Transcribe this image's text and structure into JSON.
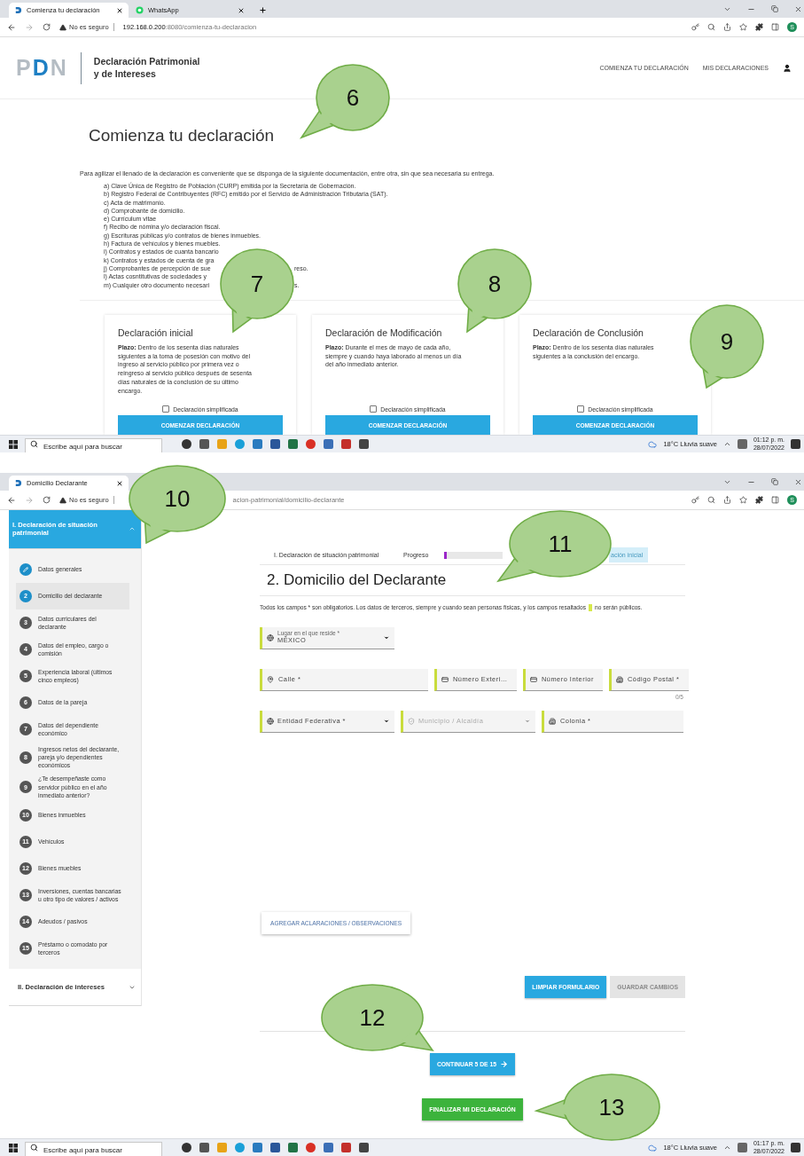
{
  "screen_1": {
    "browser": {
      "tabs": [
        {
          "title": "Comienza tu declaración",
          "kind": "pdn",
          "selected": true
        },
        {
          "title": "WhatsApp",
          "kind": "chat",
          "selected": false
        }
      ],
      "security": "No es seguro",
      "url": "**192.168.0.200**:8080/comienza-tu-declaracion",
      "profile_initial": "S"
    },
    "header": {
      "logo": "PDN",
      "app_title": [
        "Declaración Patrimonial",
        "y de Intereses"
      ],
      "nav": [
        "COMIENZA TU DECLARACIÓN",
        "MIS DECLARACIONES"
      ]
    },
    "title": "Comienza tu declaración",
    "intro": "Para agilizar el llenado de la declaración es conveniente que se disponga de la siguiente documentación, entre otra, sin que sea necesaria su entrega.",
    "documents": [
      {
        "text": "a) Clave Única de Registro de Población (CURP) emitida por la Secretaría de Gobernación."
      },
      {
        "text": "b) Registro Federal de Contribuyentes (RFC) emitido por el Servicio de Administración Tributaria (SAT)."
      },
      {
        "text": "c) Acta de matrimonio."
      },
      {
        "text": "d) Comprobante de domicilio."
      },
      {
        "text": "e) Currículum vitae"
      },
      {
        "text": "f) Recibo de nómina y/o declaración fiscal."
      },
      {
        "text": "g) Escrituras públicas y/o contratos de bienes inmuebles."
      },
      {
        "text": "h) Factura de vehículos y bienes muebles."
      },
      {
        "text": "i) Contratos y estados de cuanta bancario"
      },
      {
        "text": "k) Contratos y estados de cuenta de gra"
      },
      {
        "text": "j) Comprobantes de percepción de sue",
        "tail": "reso."
      },
      {
        "text": "l) Actas cosntitutivas de sociedades y"
      },
      {
        "text": "m) Cualquier otro documento necesari",
        "tail": "s."
      }
    ],
    "cards": [
      {
        "title": "Declaración inicial",
        "deadline": "**Plazo:** Dentro de los sesenta días naturales siguientes a la toma de posesión con motivo del ingreso al servicio público por primera vez o reingreso al servicio público después de sesenta días naturales de la conclusión de su último encargo.",
        "checkbox": "Declaración simplificada",
        "checked": false,
        "button": "COMENZAR DECLARACIÓN"
      },
      {
        "title": "Declaración de Modificación",
        "deadline": "**Plazo:** Durante el mes de mayo de cada año, siempre y cuando haya laborado al menos un día del año inmediato anterior.",
        "checkbox": "Declaración simplificada",
        "checked": false,
        "button": "COMENZAR DECLARACIÓN"
      },
      {
        "title": "Declaración de Conclusión",
        "deadline": "**Plazo:** Dentro de los sesenta días naturales siguientes a la conclusión del encargo.",
        "checkbox": "Declaración simplificada",
        "checked": false,
        "button": "COMENZAR DECLARACIÓN"
      }
    ],
    "taskbar": {
      "search_placeholder": "Escribe aquí para buscar",
      "weather": "18°C Lluvia suave",
      "time": "01:12 p. m.",
      "date": "28/07/2022"
    }
  },
  "screen_2": {
    "browser": {
      "tabs": [
        {
          "title": "Domicilio Declarante",
          "kind": "pdn",
          "selected": true
        }
      ],
      "security": "No es seguro",
      "url": "acion-patrimonial/domicilio-declarante",
      "profile_initial": "S"
    },
    "sidebar": {
      "sections": [
        {
          "title": "I. Declaración de situación patrimonial",
          "expanded": true,
          "steps": [
            {
              "kind": "edit",
              "label": "Datos generales",
              "selected": false
            },
            {
              "kind": "number",
              "number": "2",
              "label": "Domicilio del declarante",
              "selected": true
            },
            {
              "kind": "number",
              "number": "3",
              "label": "Datos curriculares del declarante",
              "selected": false
            },
            {
              "kind": "number",
              "number": "4",
              "label": "Datos del empleo, cargo o comisión",
              "selected": false
            },
            {
              "kind": "number",
              "number": "5",
              "label": "Experiencia laboral (últimos cinco empleos)",
              "selected": false
            },
            {
              "kind": "number",
              "number": "6",
              "label": "Datos de la pareja",
              "selected": false
            },
            {
              "kind": "number",
              "number": "7",
              "label": "Datos del dependiente económico",
              "selected": false
            },
            {
              "kind": "number",
              "number": "8",
              "label": "Ingresos netos del declarante, pareja y/o dependientes económicos",
              "selected": false
            },
            {
              "kind": "number",
              "number": "9",
              "label": "¿Te desempeñaste como servidor público en el año inmediato anterior?",
              "selected": false
            },
            {
              "kind": "number",
              "number": "10",
              "label": "Bienes inmuebles",
              "selected": false
            },
            {
              "kind": "number",
              "number": "11",
              "label": "Vehículos",
              "selected": false
            },
            {
              "kind": "number",
              "number": "12",
              "label": "Bienes muebles",
              "selected": false
            },
            {
              "kind": "number",
              "number": "13",
              "label": "Inversiones, cuentas bancarias u otro tipo de valores / activos",
              "selected": false
            },
            {
              "kind": "number",
              "number": "14",
              "label": "Adeudos / pasivos",
              "selected": false
            },
            {
              "kind": "number",
              "number": "15",
              "label": "Préstamo o comodato por terceros",
              "selected": false
            }
          ]
        },
        {
          "title": "II. Declaración de intereses",
          "expanded": false
        }
      ]
    },
    "progress": {
      "section": "I. Declaración de situación patrimonial",
      "label": "Progreso",
      "level": 0.05,
      "chip": "ación inicial"
    },
    "heading": "2. Domicilio del Declarante",
    "note": {
      "before": "Todos los campos * son obligatorios. Los datos de terceros, siempre y cuando sean personas físicas, y los campos resaltados",
      "after": "no serán públicos."
    },
    "field_rows": [
      [
        {
          "kind": "select",
          "label": "Lugar en el que reside *",
          "value": "MÉXICO",
          "disabled": false
        }
      ],
      [
        {
          "kind": "text",
          "placeholder": "Calle *",
          "disabled": false
        },
        {
          "kind": "text",
          "placeholder": "Número Exteri…",
          "disabled": false
        },
        {
          "kind": "text",
          "placeholder": "Número Interior",
          "disabled": false
        },
        {
          "kind": "text",
          "placeholder": "Código Postal *",
          "counter": "0/5",
          "disabled": false
        }
      ],
      [
        {
          "kind": "select",
          "placeholder": "Entidad Federativa *",
          "disabled": false
        },
        {
          "kind": "select",
          "placeholder": "Municipio / Alcaldía",
          "disabled": true
        },
        {
          "kind": "text",
          "placeholder": "Colonia *",
          "disabled": false
        }
      ]
    ],
    "notes_button": "AGREGAR ACLARACIONES / OBSERVACIONES",
    "form_buttons": [
      {
        "label": "LIMPIAR FORMULARIO",
        "disabled": false
      },
      {
        "label": "GUARDAR CAMBIOS",
        "disabled": true
      }
    ],
    "continue_button": "CONTINUAR 5 DE 15",
    "finish_button": "FINALIZAR MI DECLARACIÓN",
    "taskbar": {
      "search_placeholder": "Escribe aquí para buscar",
      "weather": "18°C Lluvia suave",
      "time": "01:17 p. m.",
      "date": "28/07/2022"
    }
  },
  "callouts": [
    {
      "label": "6"
    },
    {
      "label": "7"
    },
    {
      "label": "8"
    },
    {
      "label": "9"
    },
    {
      "label": "10"
    },
    {
      "label": "11"
    },
    {
      "label": "12"
    },
    {
      "label": "13"
    }
  ]
}
